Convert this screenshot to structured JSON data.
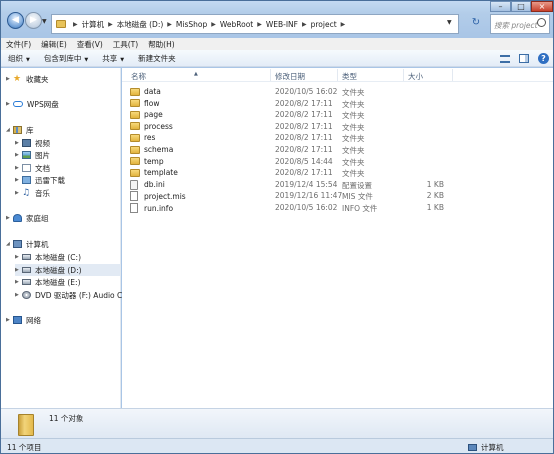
{
  "address": {
    "crumbs": [
      "计算机",
      "本地磁盘 (D:)",
      "MisShop",
      "WebRoot",
      "WEB-INF",
      "project"
    ],
    "search_placeholder": "搜索 project"
  },
  "menu": [
    "文件(F)",
    "编辑(E)",
    "查看(V)",
    "工具(T)",
    "帮助(H)"
  ],
  "toolbar": {
    "organize": "组织",
    "include_in_library": "包含到库中",
    "share": "共享",
    "new_folder": "新建文件夹"
  },
  "nav": {
    "favorites": "收藏夹",
    "wps": "WPS网盘",
    "library": "库",
    "videos": "视频",
    "pictures": "图片",
    "documents": "文档",
    "thunder": "迅雷下载",
    "music": "音乐",
    "homegroup": "家庭组",
    "computer": "计算机",
    "drive_c": "本地磁盘 (C:)",
    "drive_d": "本地磁盘 (D:)",
    "drive_e": "本地磁盘 (E:)",
    "dvd": "DVD 驱动器 (F:) Audio CD",
    "network": "网络"
  },
  "columns": {
    "name": "名称",
    "date": "修改日期",
    "type": "类型",
    "size": "大小"
  },
  "files": [
    {
      "name": "data",
      "date": "2020/10/5 16:02",
      "type": "文件夹",
      "size": "",
      "kind": "folder"
    },
    {
      "name": "flow",
      "date": "2020/8/2 17:11",
      "type": "文件夹",
      "size": "",
      "kind": "folder"
    },
    {
      "name": "page",
      "date": "2020/8/2 17:11",
      "type": "文件夹",
      "size": "",
      "kind": "folder"
    },
    {
      "name": "process",
      "date": "2020/8/2 17:11",
      "type": "文件夹",
      "size": "",
      "kind": "folder"
    },
    {
      "name": "res",
      "date": "2020/8/2 17:11",
      "type": "文件夹",
      "size": "",
      "kind": "folder"
    },
    {
      "name": "schema",
      "date": "2020/8/2 17:11",
      "type": "文件夹",
      "size": "",
      "kind": "folder"
    },
    {
      "name": "temp",
      "date": "2020/8/5 14:44",
      "type": "文件夹",
      "size": "",
      "kind": "folder"
    },
    {
      "name": "template",
      "date": "2020/8/2 17:11",
      "type": "文件夹",
      "size": "",
      "kind": "folder"
    },
    {
      "name": "db.ini",
      "date": "2019/12/4 15:54",
      "type": "配置设置",
      "size": "1 KB",
      "kind": "ini"
    },
    {
      "name": "project.mis",
      "date": "2019/12/16 11:47",
      "type": "MIS 文件",
      "size": "2 KB",
      "kind": "file"
    },
    {
      "name": "run.info",
      "date": "2020/10/5 16:02",
      "type": "INFO 文件",
      "size": "1 KB",
      "kind": "file"
    }
  ],
  "details": {
    "count": "11 个对象"
  },
  "status": {
    "items": "11 个项目",
    "location": "计算机"
  }
}
